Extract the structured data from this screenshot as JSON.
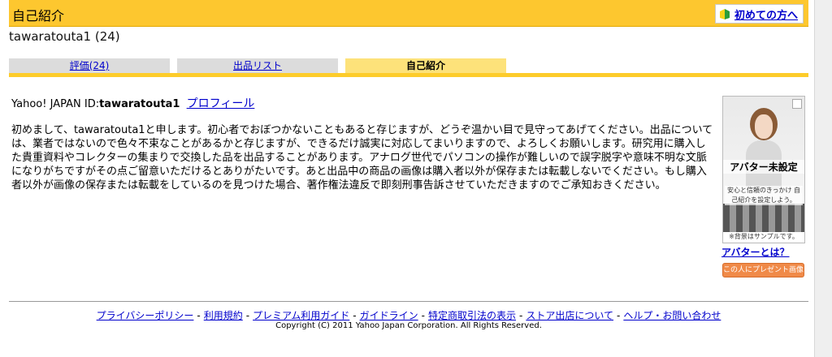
{
  "header": {
    "title": "自己紹介",
    "newcomer_link": "初めての方へ",
    "newcomer_icon": "beginner-leaf-icon"
  },
  "user": {
    "name_with_rating": "tawaratouta1 (24)"
  },
  "tabs": [
    {
      "label": "評価(24)",
      "active": false
    },
    {
      "label": "出品リスト",
      "active": false
    },
    {
      "label": "自己紹介",
      "active": true
    }
  ],
  "profile": {
    "id_label": "Yahoo! JAPAN ID:",
    "id_value": "tawaratouta1",
    "profile_link": "プロフィール",
    "intro_text": "初めまして、tawaratouta1と申します。初心者でおぼつかないこともあると存じますが、どうぞ温かい目で見守ってあげてください。出品については、業者ではないので色々不束なことがあるかと存じますが、できるだけ誠実に対応してまいりますので、よろしくお願いします。研究用に購入した貴重資料やコレクターの集まりで交換した品を出品することがあります。アナログ世代でパソコンの操作が難しいので誤字脱字や意味不明な文脈になりがちですがその点ご留意いただけるとありがたいです。あと出品中の商品の画像は購入者以外が保存または転載しないでください。もし購入者以外が画像の保存または転載をしているのを見つけた場合、著作権法違反で即刻刑事告訴させていただきますのでご承知おきください。"
  },
  "avatar": {
    "title": "アバター未設定",
    "description": "安心と信頼のきっかけ 自己紹介を設定しよう。",
    "note": "※背景はサンプルです。",
    "what_link": "アバターとは？",
    "gift_button": "この人にプレゼント画像る"
  },
  "footer": {
    "links": [
      "プライバシーポリシー",
      "利用規約",
      "プレミアム利用ガイド",
      "ガイドライン",
      "特定商取引法の表示",
      "ストア出店について",
      "ヘルプ・お問い合わせ"
    ],
    "separator": "-",
    "copyright": "Copyright (C) 2011 Yahoo Japan Corporation. All Rights Reserved."
  },
  "colors": {
    "header_bg": "#fdc72f",
    "active_tab_bg": "#fde27a",
    "tab_bg": "#dcdcdc",
    "link": "#0000cc",
    "gift_button_bg": "#f08a48"
  }
}
